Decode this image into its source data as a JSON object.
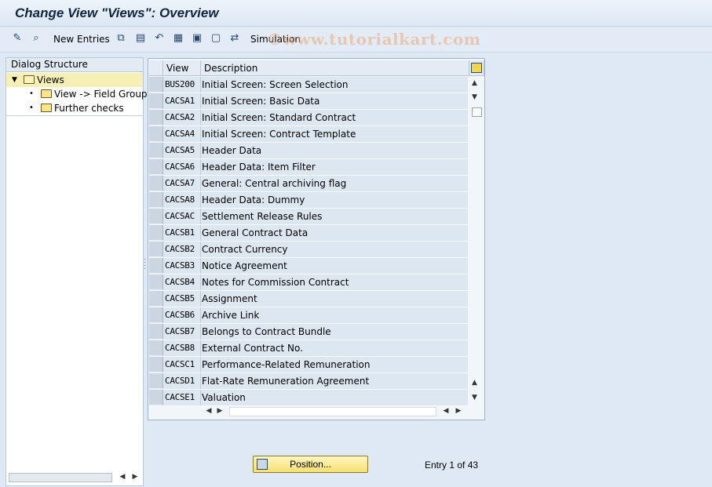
{
  "window": {
    "title": "Change View \"Views\": Overview"
  },
  "toolbar": {
    "items": [
      {
        "icon": "pencil-glasses-icon",
        "glyph": "✎"
      },
      {
        "icon": "magnifier-icon",
        "glyph": "⌕"
      },
      {
        "label": "New Entries"
      },
      {
        "icon": "copy-icon",
        "glyph": "⧉"
      },
      {
        "icon": "delete-icon",
        "glyph": "▤"
      },
      {
        "icon": "undo-icon",
        "glyph": "↶"
      },
      {
        "icon": "select-all-icon",
        "glyph": "▦"
      },
      {
        "icon": "select-block-icon",
        "glyph": "▣"
      },
      {
        "icon": "deselect-all-icon",
        "glyph": "▢"
      },
      {
        "icon": "transport-icon",
        "glyph": "⇄"
      },
      {
        "label": "Simulation"
      }
    ],
    "new_entries_label": "New Entries",
    "simulation_label": "Simulation"
  },
  "watermark": "©www.tutorialkart.com",
  "dialog_structure": {
    "header": "Dialog Structure",
    "items": [
      {
        "label": "Views",
        "level": 0,
        "selected": true,
        "expanded": true
      },
      {
        "label": "View -> Field Groups",
        "level": 1,
        "selected": false
      },
      {
        "label": "Further checks",
        "level": 1,
        "selected": false
      }
    ]
  },
  "table": {
    "columns": [
      "View",
      "Description"
    ],
    "rows": [
      {
        "view": "BUS200",
        "description": "Initial Screen: Screen Selection"
      },
      {
        "view": "CACSA1",
        "description": "Initial Screen: Basic Data"
      },
      {
        "view": "CACSA2",
        "description": "Initial Screen: Standard Contract"
      },
      {
        "view": "CACSA4",
        "description": "Initial Screen: Contract Template"
      },
      {
        "view": "CACSA5",
        "description": "Header Data"
      },
      {
        "view": "CACSA6",
        "description": "Header Data: Item Filter"
      },
      {
        "view": "CACSA7",
        "description": "General: Central archiving flag"
      },
      {
        "view": "CACSA8",
        "description": "Header Data: Dummy"
      },
      {
        "view": "CACSAC",
        "description": "Settlement Release Rules"
      },
      {
        "view": "CACSB1",
        "description": "General Contract Data"
      },
      {
        "view": "CACSB2",
        "description": "Contract Currency"
      },
      {
        "view": "CACSB3",
        "description": "Notice Agreement"
      },
      {
        "view": "CACSB4",
        "description": "Notes for Commission Contract"
      },
      {
        "view": "CACSB5",
        "description": "Assignment"
      },
      {
        "view": "CACSB6",
        "description": "Archive Link"
      },
      {
        "view": "CACSB7",
        "description": "Belongs to Contract Bundle"
      },
      {
        "view": "CACSB8",
        "description": "External Contract No."
      },
      {
        "view": "CACSC1",
        "description": "Performance-Related Remuneration"
      },
      {
        "view": "CACSD1",
        "description": "Flat-Rate Remuneration Agreement"
      },
      {
        "view": "CACSE1",
        "description": "Valuation"
      }
    ]
  },
  "position_button": {
    "label": "Position..."
  },
  "entry_status": "Entry 1 of 43"
}
